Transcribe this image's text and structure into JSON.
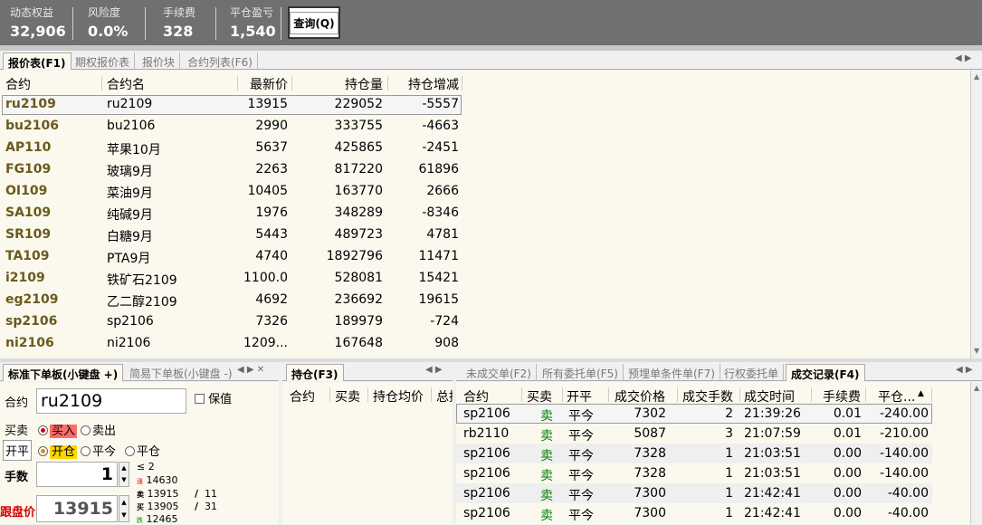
{
  "topbar": {
    "metrics": [
      {
        "label": "动态权益",
        "value": "32,906"
      },
      {
        "label": "风险度",
        "value": "0.0%"
      },
      {
        "label": "手续费",
        "value": "328"
      },
      {
        "label": "平仓盈亏",
        "value": "1,540"
      }
    ],
    "query_button": "查询(Q)"
  },
  "quote_tabs": [
    "报价表(F1)",
    "期权报价表",
    "报价块",
    "合约列表(F6)"
  ],
  "quote_table": {
    "headers": [
      "合约",
      "合约名",
      "最新价",
      "持仓量",
      "持仓增减"
    ],
    "rows": [
      [
        "ru2109",
        "ru2109",
        "13915",
        "229052",
        "-5557"
      ],
      [
        "bu2106",
        "bu2106",
        "2990",
        "333755",
        "-4663"
      ],
      [
        "AP110",
        "苹果10月",
        "5637",
        "425865",
        "-2451"
      ],
      [
        "FG109",
        "玻璃9月",
        "2263",
        "817220",
        "61896"
      ],
      [
        "OI109",
        "菜油9月",
        "10405",
        "163770",
        "2666"
      ],
      [
        "SA109",
        "纯碱9月",
        "1976",
        "348289",
        "-8346"
      ],
      [
        "SR109",
        "白糖9月",
        "5443",
        "489723",
        "4781"
      ],
      [
        "TA109",
        "PTA9月",
        "4740",
        "1892796",
        "11471"
      ],
      [
        "i2109",
        "铁矿石2109",
        "1100.0",
        "528081",
        "15421"
      ],
      [
        "eg2109",
        "乙二醇2109",
        "4692",
        "236692",
        "19615"
      ],
      [
        "sp2106",
        "sp2106",
        "7326",
        "189979",
        "-724"
      ],
      [
        "ni2106",
        "ni2106",
        "1209...",
        "167648",
        "908"
      ]
    ]
  },
  "order_panel": {
    "tabs": [
      "标准下单板(小键盘 +)",
      "简易下单板(小键盘 -)"
    ],
    "contract_label": "合约",
    "contract_value": "ru2109",
    "keep_label": "保值",
    "direction_label": "买卖",
    "buy": "买入",
    "sell": "卖出",
    "offset_label": "开平",
    "open": "开仓",
    "close_today": "平今",
    "close": "平仓",
    "qty_label": "手数",
    "qty_value": "1",
    "price_label": "跟盘价",
    "price_value": "13915",
    "depth": {
      "limit_up_mark": "≤",
      "limit_up_qty": "2",
      "up_price_mark": "涨",
      "up_price": "14630",
      "ask_mark": "卖",
      "ask_price": "13915",
      "ask_slash": "/",
      "ask_vol": "11",
      "bid_mark": "买",
      "bid_price": "13905",
      "bid_slash": "/",
      "bid_vol": "31",
      "down_mark": "跌",
      "down_price": "12465"
    }
  },
  "position_panel": {
    "tab": "持仓(F3)",
    "headers": [
      "合约",
      "买卖",
      "持仓均价",
      "总持"
    ]
  },
  "trade_panel": {
    "tabs": [
      "未成交单(F2)",
      "所有委托单(F5)",
      "预埋单条件单(F7)",
      "行权委托单",
      "成交记录(F4)"
    ],
    "headers": [
      "合约",
      "买卖",
      "开平",
      "成交价格",
      "成交手数",
      "成交时间",
      "手续费",
      "平仓..."
    ],
    "rows": [
      [
        "sp2106",
        "卖",
        "平今",
        "7302",
        "2",
        "21:39:26",
        "0.01",
        "-240.00"
      ],
      [
        "rb2110",
        "卖",
        "平今",
        "5087",
        "3",
        "21:07:59",
        "0.01",
        "-210.00"
      ],
      [
        "sp2106",
        "卖",
        "平今",
        "7328",
        "1",
        "21:03:51",
        "0.00",
        "-140.00"
      ],
      [
        "sp2106",
        "卖",
        "平今",
        "7328",
        "1",
        "21:03:51",
        "0.00",
        "-140.00"
      ],
      [
        "sp2106",
        "卖",
        "平今",
        "7300",
        "1",
        "21:42:41",
        "0.00",
        "-40.00"
      ],
      [
        "sp2106",
        "卖",
        "平今",
        "7300",
        "1",
        "21:42:41",
        "0.00",
        "-40.00"
      ]
    ]
  },
  "colors": {
    "topbar": "#707070",
    "panel": "#fbf9ee",
    "code": "#6b5a1e",
    "sell": "#008000",
    "buy_hl": "#ff6a6a",
    "open_hl": "#ffd700"
  }
}
